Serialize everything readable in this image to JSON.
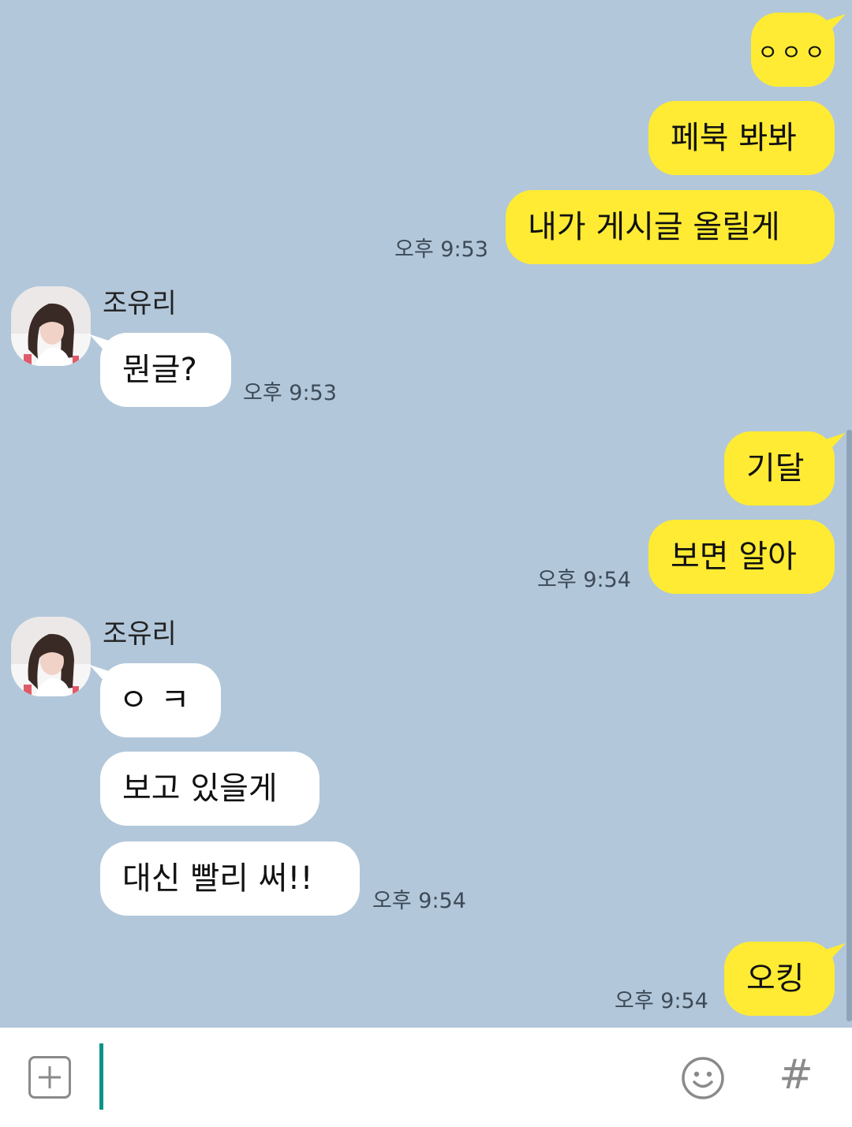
{
  "chat": {
    "messages": [
      {
        "from": "me",
        "text": "ㅇㅇㅇ"
      },
      {
        "from": "me",
        "text": "페북 봐봐"
      },
      {
        "from": "me",
        "text": "내가 게시글 올릴게",
        "time": "오후 9:53"
      },
      {
        "from": "other",
        "sender": "조유리",
        "text": "뭔글?",
        "time": "오후 9:53"
      },
      {
        "from": "me",
        "text": "기달"
      },
      {
        "from": "me",
        "text": "보면 알아",
        "time": "오후 9:54"
      },
      {
        "from": "other",
        "sender": "조유리",
        "text": "ㅇㅋ"
      },
      {
        "from": "other",
        "text": "보고 있을게"
      },
      {
        "from": "other",
        "text": "대신 빨리 써!!",
        "time": "오후 9:54"
      },
      {
        "from": "me",
        "text": "오킹",
        "time": "오후 9:54"
      }
    ]
  },
  "input": {
    "value": "",
    "add_icon": "plus-square-icon",
    "emoji_icon": "smiley-icon",
    "hashtag_icon": "hash-icon"
  },
  "colors": {
    "chat_background": "#b2c7da",
    "my_bubble": "#ffeb33",
    "other_bubble": "#ffffff",
    "caret": "#0d9488"
  }
}
